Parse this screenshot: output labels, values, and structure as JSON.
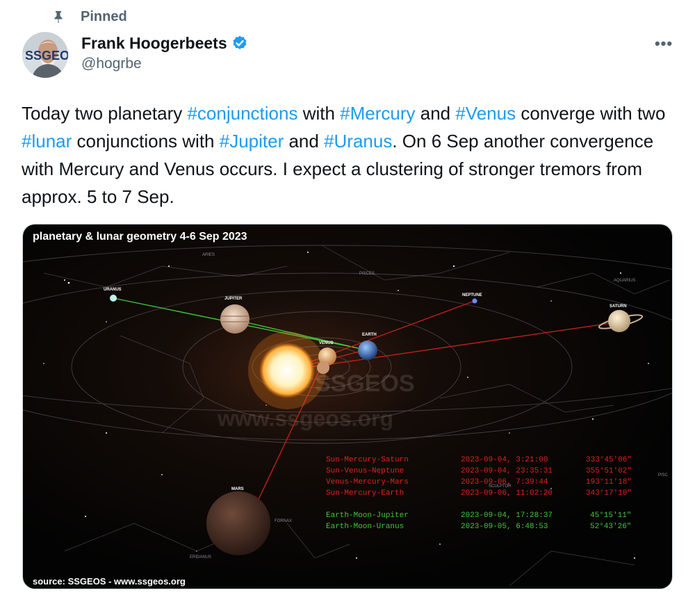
{
  "pinned": {
    "label": "Pinned",
    "icon": "pin-icon"
  },
  "author": {
    "name": "Frank Hoogerbeets",
    "handle": "@hogrbe",
    "verified": true,
    "avatar_text": "SSGEOS"
  },
  "more_label": "•••",
  "tweet": {
    "t1": "Today two planetary ",
    "h1": "#conjunctions",
    "t2": " with ",
    "h2": "#Mercury",
    "t3": " and ",
    "h3": "#Venus",
    "t4": " converge with two ",
    "h4": "#lunar",
    "t5": " conjunctions with ",
    "h5": "#Jupiter",
    "t6": " and ",
    "h6": "#Uranus",
    "t7": ". On 6 Sep another convergence with Mercury and Venus occurs. I expect a clustering of stronger tremors from approx. 5 to 7 Sep."
  },
  "image": {
    "title": "planetary & lunar geometry 4-6 Sep 2023",
    "source": "source: SSGEOS - www.ssgeos.org",
    "watermark_logo": "SSGEOS",
    "watermark_url": "www.ssgeos.org",
    "planets": {
      "uranus": "URANUS",
      "jupiter": "JUPITER",
      "neptune": "NEPTUNE",
      "saturn": "SATURN",
      "venus": "VENUS",
      "earth": "EARTH",
      "mars": "MARS"
    },
    "constellations": {
      "aries": "ARIES",
      "pisces": "PISCES",
      "aquarius": "AQUARIUS",
      "eridanus": "ERIDANUS",
      "fornax": "FORNAX",
      "sculptor": "SCULPTOR",
      "pisc2": "PISC"
    },
    "events_red": [
      {
        "name": "Sun-Mercury-Saturn",
        "datetime": "2023-09-04,  3:21:00",
        "angle": "333°45'06\""
      },
      {
        "name": "Sun-Venus-Neptune",
        "datetime": "2023-09-04, 23:35:31",
        "angle": "355°51'02\""
      },
      {
        "name": "Venus-Mercury-Mars",
        "datetime": "2023-09-06,  7:39:44",
        "angle": "193°11'18\""
      },
      {
        "name": "Sun-Mercury-Earth",
        "datetime": "2023-09-06, 11:02:20",
        "angle": "343°17'10\""
      }
    ],
    "events_green": [
      {
        "name": "Earth-Moon-Jupiter",
        "datetime": "2023-09-04, 17:28:37",
        "angle": "45°15'11\""
      },
      {
        "name": "Earth-Moon-Uranus",
        "datetime": "2023-09-05,  6:48:53",
        "angle": "52°43'26\""
      }
    ],
    "colors": {
      "red": "#e0231b",
      "green": "#3ec83a",
      "link": "#1d9bf0"
    }
  }
}
